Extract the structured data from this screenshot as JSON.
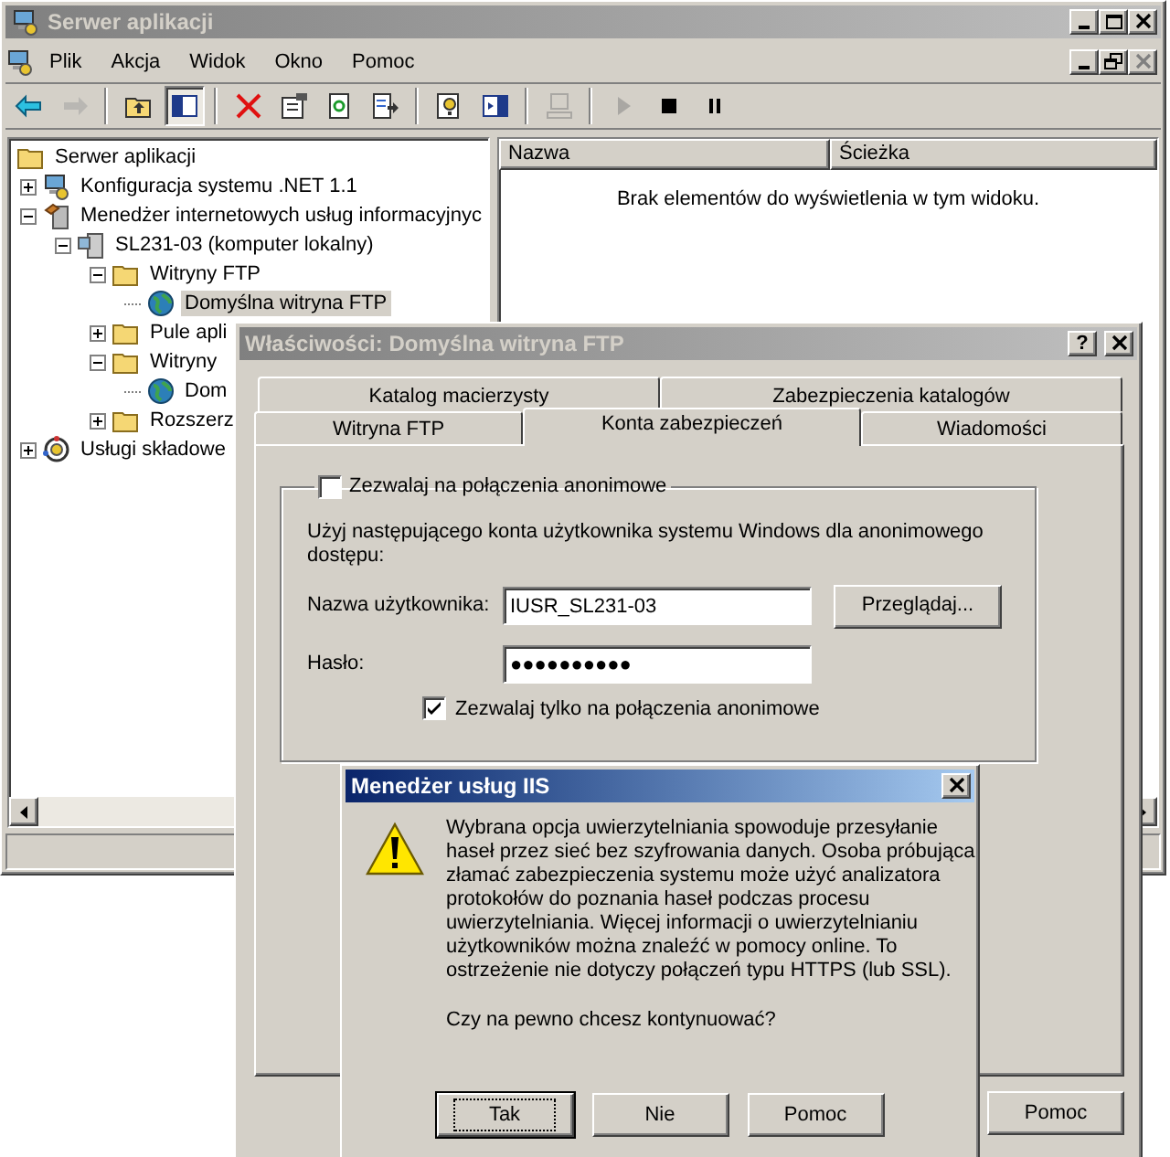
{
  "main_window": {
    "title": "Serwer aplikacji",
    "active": false,
    "window_controls": [
      {
        "kind": "minimize",
        "disabled": false
      },
      {
        "kind": "maximize",
        "disabled": false
      },
      {
        "kind": "close",
        "disabled": false
      }
    ],
    "menu": [
      {
        "label": "Plik"
      },
      {
        "label": "Akcja"
      },
      {
        "label": "Widok"
      },
      {
        "label": "Okno"
      },
      {
        "label": "Pomoc"
      }
    ],
    "mdi_controls": [
      {
        "kind": "minimize",
        "disabled": false
      },
      {
        "kind": "restore",
        "disabled": false
      },
      {
        "kind": "close",
        "disabled": true
      }
    ],
    "toolbar": [
      [
        {
          "kind": "back",
          "disabled": false,
          "pressed": false
        },
        {
          "kind": "forward",
          "disabled": true,
          "pressed": false
        }
      ],
      [
        {
          "kind": "up",
          "disabled": false,
          "pressed": false
        },
        {
          "kind": "tree",
          "disabled": false,
          "pressed": true
        }
      ],
      [
        {
          "kind": "delete",
          "disabled": false,
          "pressed": false
        },
        {
          "kind": "properties",
          "disabled": false,
          "pressed": false
        },
        {
          "kind": "refresh",
          "disabled": false,
          "pressed": false
        },
        {
          "kind": "export",
          "disabled": false,
          "pressed": false
        }
      ],
      [
        {
          "kind": "help",
          "disabled": false,
          "pressed": false
        },
        {
          "kind": "pane",
          "disabled": false,
          "pressed": false
        }
      ],
      [
        {
          "kind": "computer",
          "disabled": true,
          "pressed": false
        }
      ],
      [
        {
          "kind": "play",
          "disabled": true,
          "pressed": false
        },
        {
          "kind": "stop",
          "disabled": false,
          "pressed": false
        },
        {
          "kind": "pause",
          "disabled": false,
          "pressed": false
        }
      ]
    ],
    "tree": [
      {
        "label": "Serwer aplikacji",
        "kind": "folder",
        "selected": false,
        "children": [
          {
            "label": "Konfiguracja systemu .NET 1.1",
            "kind": "config",
            "expanded": false,
            "selected": false
          },
          {
            "label": "Menedżer internetowych usług informacyjnyc",
            "kind": "iis",
            "expanded": true,
            "selected": false,
            "children": [
              {
                "label": "SL231-03 (komputer lokalny)",
                "kind": "computer",
                "expanded": true,
                "selected": false,
                "children": [
                  {
                    "label": "Witryny FTP",
                    "kind": "folder",
                    "expanded": true,
                    "selected": false,
                    "children": [
                      {
                        "label": "Domyślna witryna FTP",
                        "kind": "globe",
                        "selected": true
                      }
                    ]
                  },
                  {
                    "label": "Pule apli",
                    "kind": "folder",
                    "expanded": false,
                    "selected": false
                  },
                  {
                    "label": "Witryny",
                    "kind": "folder",
                    "expanded": true,
                    "selected": false,
                    "children": [
                      {
                        "label": "Dom",
                        "kind": "globe",
                        "selected": false
                      }
                    ]
                  },
                  {
                    "label": "Rozszerz",
                    "kind": "folder",
                    "expanded": false,
                    "selected": false
                  }
                ]
              }
            ]
          },
          {
            "label": "Usługi składowe",
            "kind": "components",
            "expanded": false,
            "selected": false
          }
        ]
      }
    ],
    "list": {
      "columns": [
        "Nazwa",
        "Ścieżka"
      ],
      "empty_message": "Brak elementów do wyświetlenia w tym widoku."
    }
  },
  "properties_dialog": {
    "title": "Właściwości: Domyślna witryna FTP",
    "active": false,
    "help_button": "?",
    "tab_rows": [
      [
        {
          "label": "Katalog macierzysty",
          "selected": false
        },
        {
          "label": "Zabezpieczenia katalogów",
          "selected": false
        }
      ],
      [
        {
          "label": "Witryna FTP",
          "selected": false
        },
        {
          "label": "Konta zabezpieczeń",
          "selected": true
        },
        {
          "label": "Wiadomości",
          "selected": false
        }
      ]
    ],
    "anonymous_checkbox": {
      "label": "Zezwalaj na połączenia anonimowe",
      "checked": false
    },
    "description": "Użyj następującego konta użytkownika systemu Windows dla anonimowego dostępu:",
    "fields": [
      {
        "label": "Nazwa użytkownika:",
        "value": "IUSR_SL231-03"
      },
      {
        "label": "Hasło:",
        "value": "●●●●●●●●●●"
      }
    ],
    "browse_button": "Przeglądaj...",
    "only_anonymous_checkbox": {
      "label": "Zezwalaj tylko na połączenia anonimowe",
      "checked": true
    },
    "buttons": [
      {
        "label": "Pomoc"
      }
    ]
  },
  "message_box": {
    "title": "Menedżer usług IIS",
    "active": true,
    "message": "Wybrana opcja uwierzytelniania spowoduje przesyłanie haseł przez sieć bez szyfrowania danych. Osoba próbująca złamać zabezpieczenia systemu może użyć analizatora protokołów do poznania haseł podczas procesu uwierzytelniania. Więcej informacji o uwierzytelnianiu użytkowników można znaleźć w pomocy online. To ostrzeżenie nie dotyczy połączeń typu HTTPS (lub SSL).",
    "question": "Czy na pewno chcesz kontynuować?",
    "buttons": [
      {
        "label": "Tak",
        "default": true
      },
      {
        "label": "Nie",
        "default": false
      },
      {
        "label": "Pomoc",
        "default": false
      }
    ]
  }
}
